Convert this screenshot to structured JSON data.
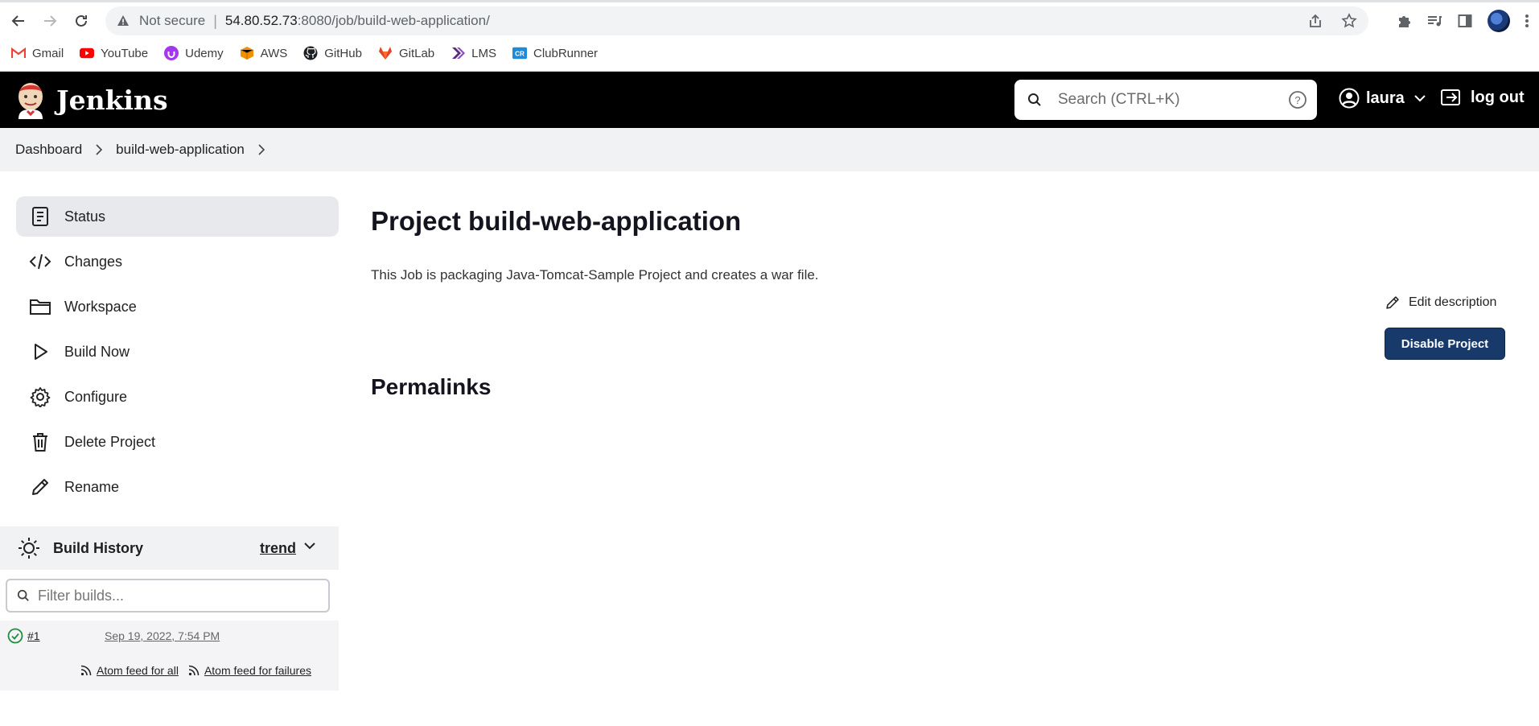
{
  "browser": {
    "omnibox": {
      "security_label": "Not secure",
      "separator": "|",
      "url_host": "54.80.52.73",
      "url_rest": ":8080/job/build-web-application/"
    },
    "bookmarks": [
      {
        "label": "Gmail",
        "icon": "gmail-icon",
        "color": "#ea4335"
      },
      {
        "label": "YouTube",
        "icon": "youtube-icon",
        "color": "#ff0000"
      },
      {
        "label": "Udemy",
        "icon": "udemy-icon",
        "color": "#a435f0"
      },
      {
        "label": "AWS",
        "icon": "aws-icon",
        "color": "#f29100"
      },
      {
        "label": "GitHub",
        "icon": "github-icon",
        "color": "#1b1f23"
      },
      {
        "label": "GitLab",
        "icon": "gitlab-icon",
        "color": "#e24329"
      },
      {
        "label": "LMS",
        "icon": "lms-icon",
        "color": "#5b2b82"
      },
      {
        "label": "ClubRunner",
        "icon": "clubrunner-icon",
        "color": "#1f8ad8"
      }
    ]
  },
  "header": {
    "app_title": "Jenkins",
    "search_placeholder": "Search (CTRL+K)",
    "user": "laura",
    "logout": "log out",
    "background": "#000000"
  },
  "breadcrumb": {
    "items": [
      "Dashboard",
      "build-web-application"
    ]
  },
  "sidebar": {
    "tasks": [
      {
        "label": "Status",
        "icon": "notepad-icon",
        "active": true
      },
      {
        "label": "Changes",
        "icon": "code-icon"
      },
      {
        "label": "Workspace",
        "icon": "folder-icon"
      },
      {
        "label": "Build Now",
        "icon": "play-icon"
      },
      {
        "label": "Configure",
        "icon": "gear-icon"
      },
      {
        "label": "Delete Project",
        "icon": "trash-icon"
      },
      {
        "label": "Rename",
        "icon": "pencil-icon"
      }
    ],
    "build_history": {
      "title": "Build History",
      "trend_label": "trend",
      "filter_placeholder": "Filter builds...",
      "builds": [
        {
          "number": "#1",
          "date": "Sep 19, 2022, 7:54 PM",
          "status": "success"
        }
      ],
      "feeds": {
        "all": "Atom feed for all",
        "failures": "Atom feed for failures"
      }
    }
  },
  "main": {
    "title": "Project build-web-application",
    "description": "This Job is packaging Java-Tomcat-Sample Project and creates a war file.",
    "edit_description": "Edit description",
    "disable_button": "Disable Project",
    "permalinks_heading": "Permalinks",
    "accent": "#173a6b"
  }
}
